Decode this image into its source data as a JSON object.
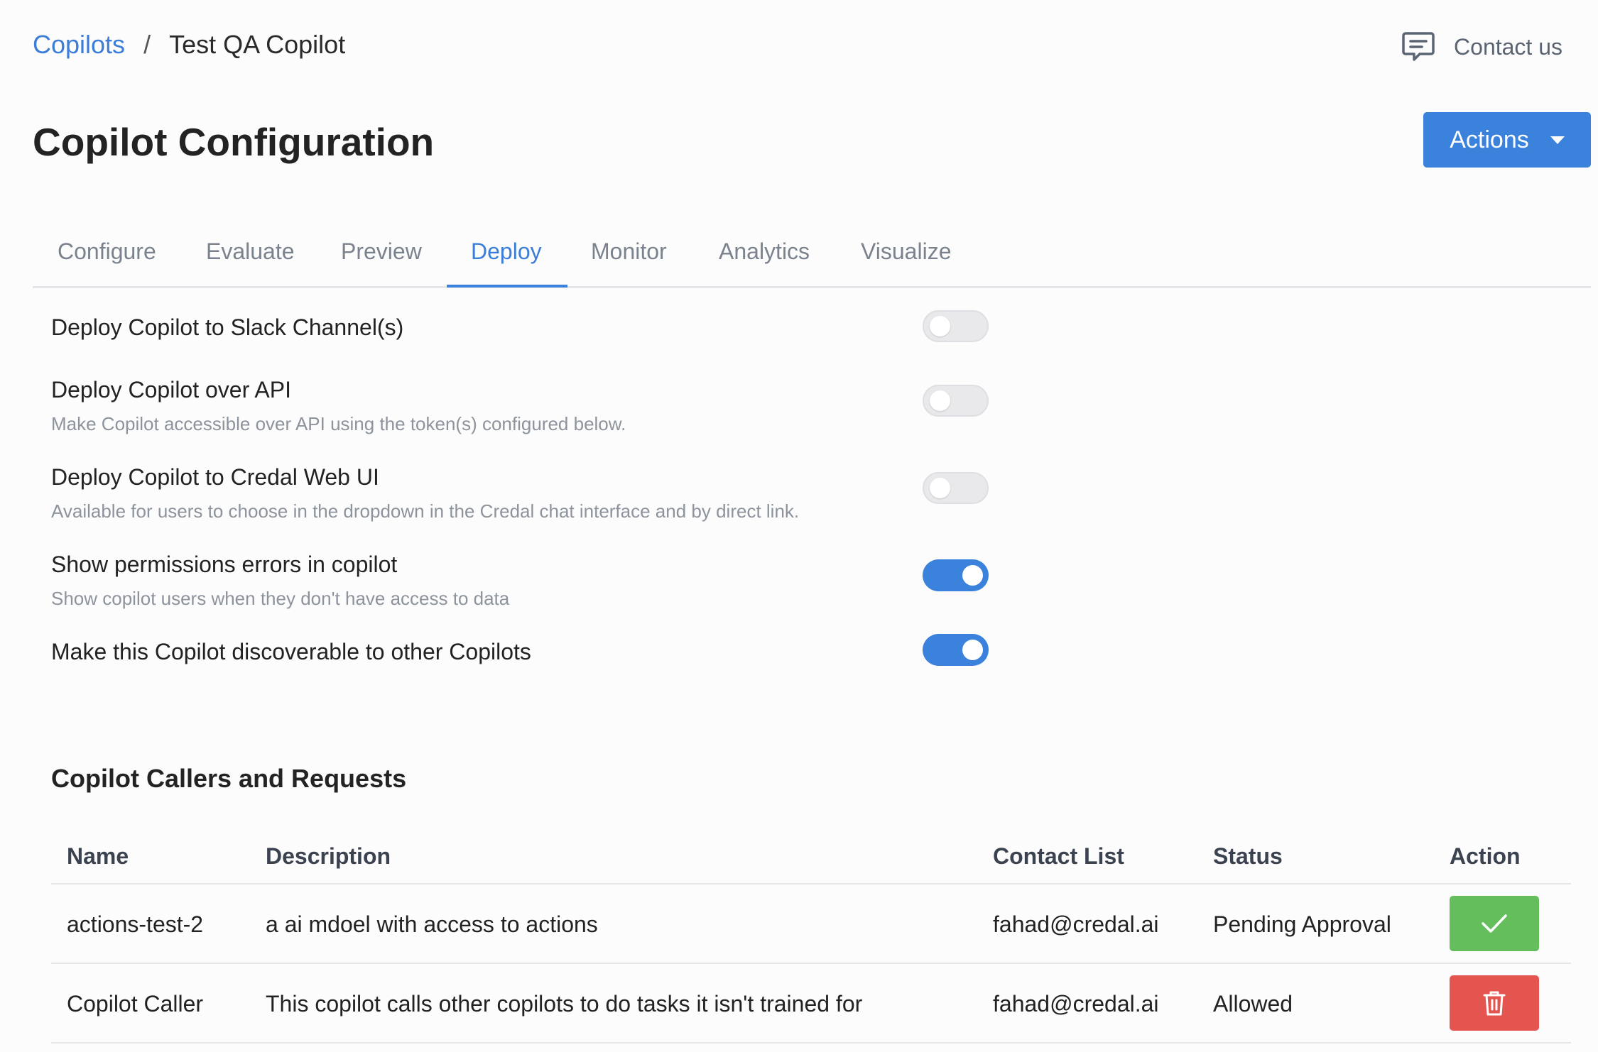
{
  "breadcrumb": {
    "parent": "Copilots",
    "separator": "/",
    "current": "Test QA Copilot"
  },
  "header": {
    "contact_label": "Contact us",
    "contact_icon": "chat-bubble-icon"
  },
  "page": {
    "title": "Copilot Configuration"
  },
  "actions": {
    "label": "Actions",
    "icon": "caret-down-icon",
    "color": "#3b82dc"
  },
  "tabs": [
    {
      "label": "Configure",
      "active": false
    },
    {
      "label": "Evaluate",
      "active": false
    },
    {
      "label": "Preview",
      "active": false
    },
    {
      "label": "Deploy",
      "active": true
    },
    {
      "label": "Monitor",
      "active": false
    },
    {
      "label": "Analytics",
      "active": false
    },
    {
      "label": "Visualize",
      "active": false
    }
  ],
  "settings": [
    {
      "label": "Deploy Copilot to Slack Channel(s)",
      "description": "",
      "enabled": false
    },
    {
      "label": "Deploy Copilot over API",
      "description": "Make Copilot accessible over API using the token(s) configured below.",
      "enabled": false
    },
    {
      "label": "Deploy Copilot to Credal Web UI",
      "description": "Available for users to choose in the dropdown in the Credal chat interface and by direct link.",
      "enabled": false
    },
    {
      "label": "Show permissions errors in copilot",
      "description": "Show copilot users when they don't have access to data",
      "enabled": true
    },
    {
      "label": "Make this Copilot discoverable to other Copilots",
      "description": "",
      "enabled": true
    }
  ],
  "callers": {
    "title": "Copilot Callers and Requests",
    "columns": [
      "Name",
      "Description",
      "Contact List",
      "Status",
      "Action"
    ],
    "rows": [
      {
        "name": "actions-test-2",
        "description": "a ai mdoel with access to actions",
        "contact": "fahad@credal.ai",
        "status": "Pending Approval",
        "action": "approve",
        "action_icon": "check-icon",
        "action_color": "#64be5c"
      },
      {
        "name": "Copilot Caller",
        "description": "This copilot calls other copilots to do tasks it isn't trained for",
        "contact": "fahad@credal.ai",
        "status": "Allowed",
        "action": "delete",
        "action_icon": "trash-icon",
        "action_color": "#e5554f"
      }
    ]
  }
}
